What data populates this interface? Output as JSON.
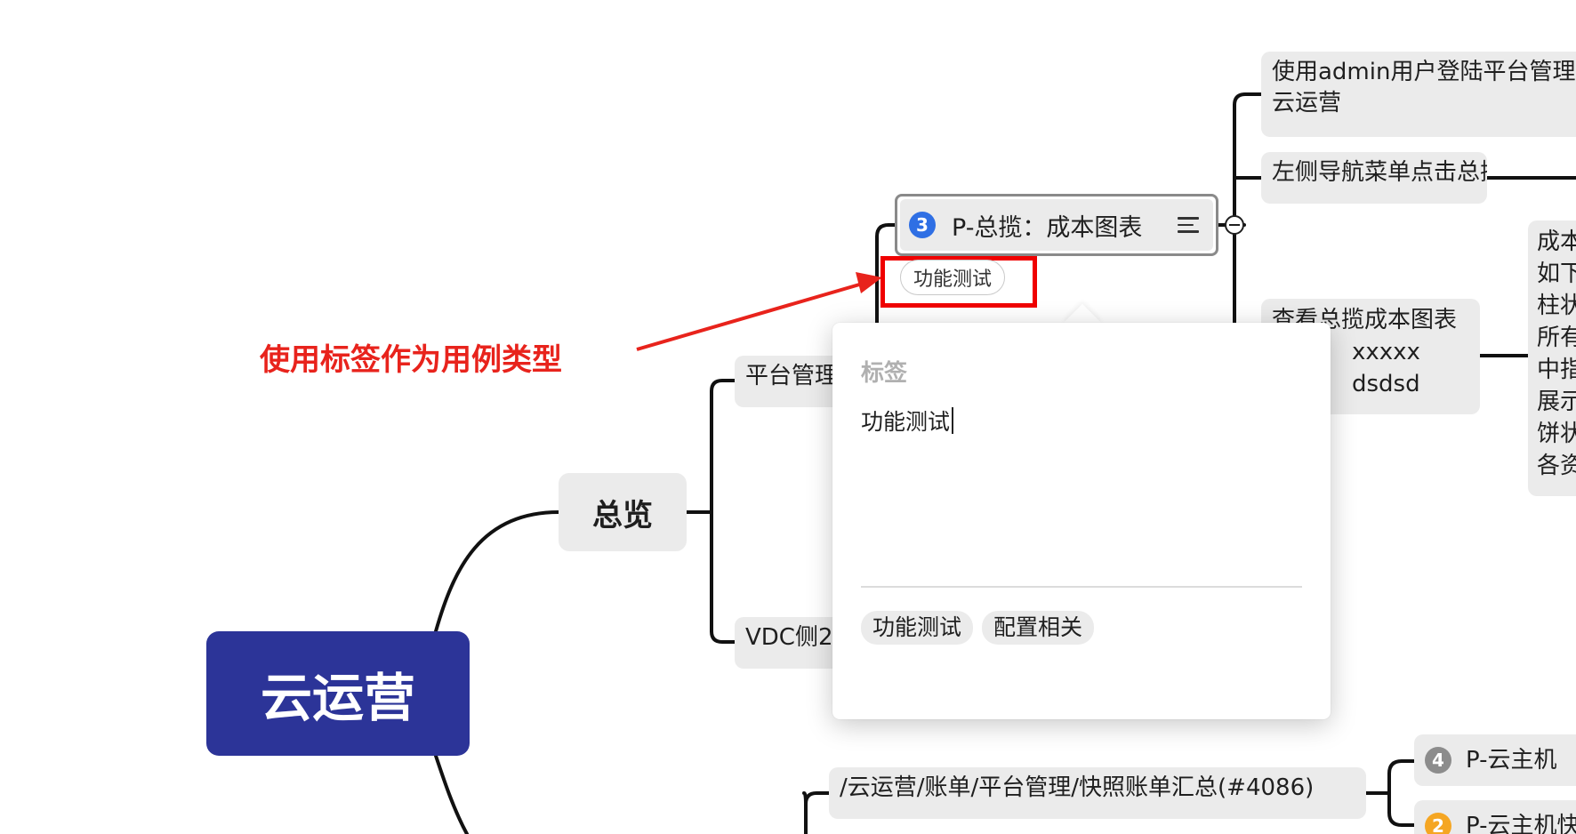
{
  "root": {
    "label": "云运营"
  },
  "overview": {
    "label": "总览"
  },
  "branches": {
    "platform": "平台管理",
    "vdc": "VDC侧2"
  },
  "selected_node": {
    "badge": "3",
    "badge_color": "#2f6fe4",
    "label": "P-总揽：成本图表",
    "tag": "功能测试"
  },
  "right_nodes": {
    "login": [
      "使用admin用户登陆平台管理",
      "云运营"
    ],
    "nav": "左侧导航菜单点击总揽",
    "view": [
      "查看总揽成本图表",
      "xxxxx",
      "dsdsd"
    ],
    "result": [
      "成本",
      "如下",
      "柱状",
      "所有",
      "中指",
      "展示",
      "饼状",
      "各资"
    ]
  },
  "bottom": {
    "path": "/云运营/账单/平台管理/快照账单汇总(#4086)",
    "node4": {
      "badge": "4",
      "badge_color": "#8c8c8c",
      "label": "P-云主机"
    },
    "node2": {
      "badge": "2",
      "badge_color": "#f5a623",
      "label": "P-云主机快"
    }
  },
  "annotation": "使用标签作为用例类型",
  "annotation_color": "#e8231c",
  "popup": {
    "title": "标签",
    "input_value": "功能测试",
    "suggestions": [
      "功能测试",
      "配置相关"
    ]
  },
  "colors": {
    "root": "#2c3498",
    "highlight": "#f00000"
  }
}
